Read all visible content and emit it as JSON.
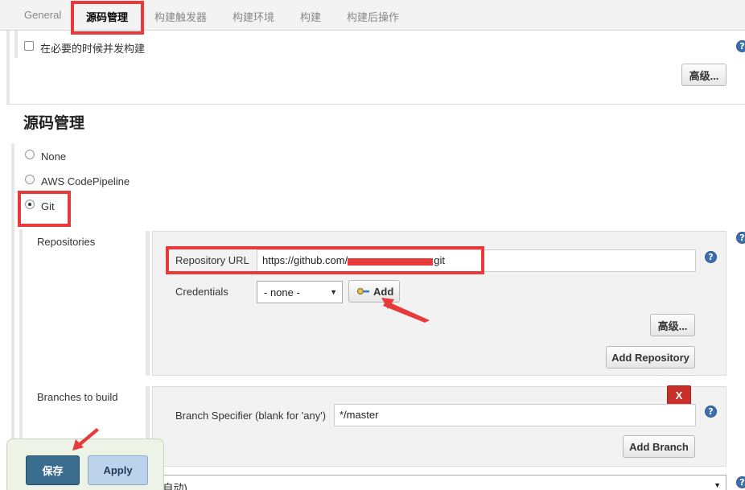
{
  "tabs": [
    {
      "label": "General"
    },
    {
      "label": "源码管理"
    },
    {
      "label": "构建触发器"
    },
    {
      "label": "构建环境"
    },
    {
      "label": "构建"
    },
    {
      "label": "构建后操作"
    }
  ],
  "general": {
    "concurrent_build_label": "在必要的时候并发构建",
    "advanced_label": "高级..."
  },
  "scm": {
    "section_title": "源码管理",
    "options": [
      "None",
      "AWS CodePipeline",
      "Git"
    ],
    "selected": "Git",
    "repositories_label": "Repositories",
    "repo_url_label": "Repository URL",
    "repo_url_value": "https://github.com/",
    "repo_url_suffix": "git",
    "credentials_label": "Credentials",
    "credentials_value": "- none -",
    "add_label": "Add",
    "advanced_label": "高级...",
    "add_repository_label": "Add Repository",
    "branches_label": "Branches to build",
    "delete_label": "X",
    "branch_specifier_label": "Branch Specifier (blank for 'any')",
    "branch_specifier_value": "*/master",
    "add_branch_label": "Add Branch",
    "browser_value": "(自动)"
  },
  "footer": {
    "save_label": "保存",
    "apply_label": "Apply"
  },
  "colors": {
    "highlight_red": "#e83a3a",
    "save_blue": "#3b6d8e",
    "apply_blue": "#bdd3ec",
    "help_blue": "#3c6fb0",
    "delete_red": "#c9302c"
  },
  "icons": [
    "help-icon",
    "key-icon",
    "arrow-annotation"
  ]
}
